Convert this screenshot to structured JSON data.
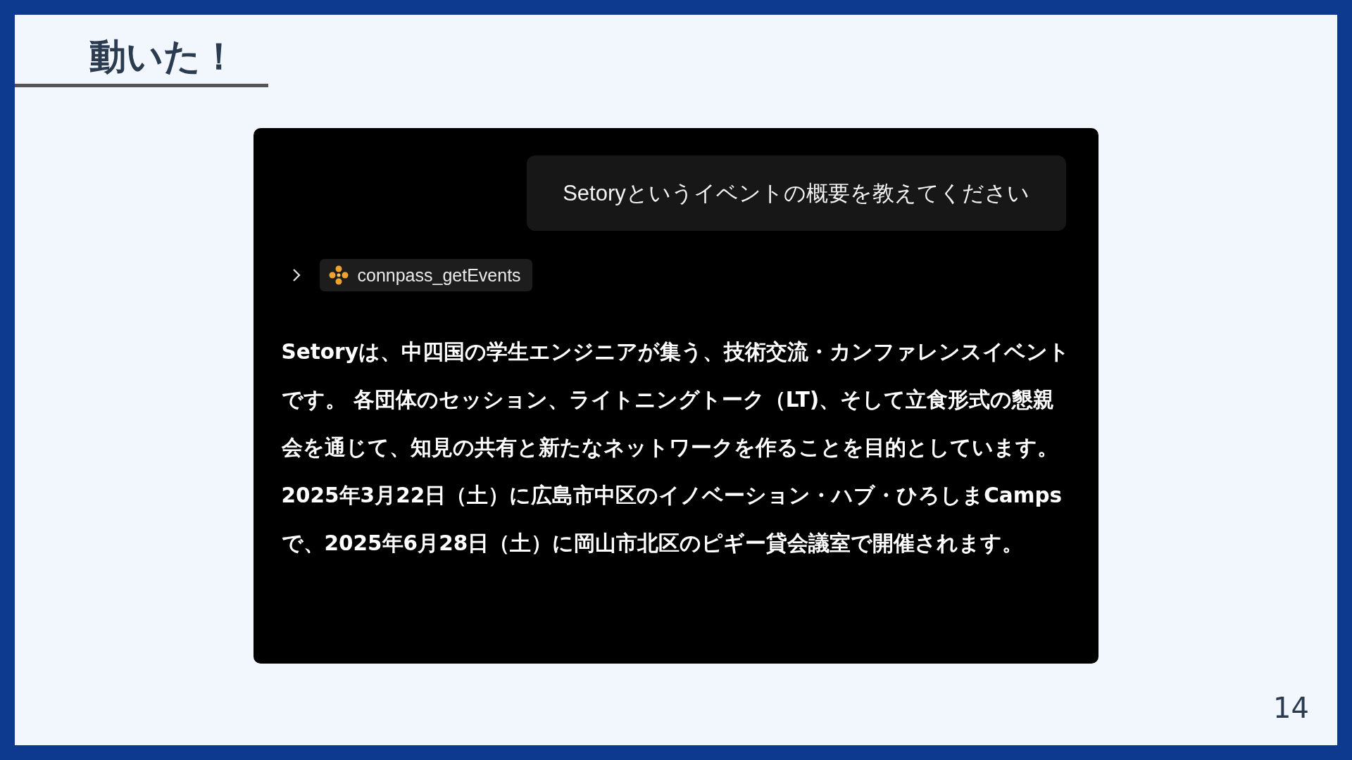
{
  "slide": {
    "title": "動いた！",
    "page_number": "14"
  },
  "chat": {
    "user_message": "Setoryというイベントの概要を教えてください",
    "tool_call": {
      "name": "connpass_getEvents",
      "expanded": false
    },
    "response": "Setoryは、中四国の学生エンジニアが集う、技術交流・カンファレンスイベントです。 各団体のセッション、ライトニングトーク（LT)、そして立食形式の懇親会を通じて、知見の共有と新たなネットワークを作ることを目的としています。 2025年3月22日（土）に広島市中区のイノベーション・ハブ・ひろしまCampsで、2025年6月28日（土）に岡山市北区のピギー貸会議室で開催されます。"
  }
}
